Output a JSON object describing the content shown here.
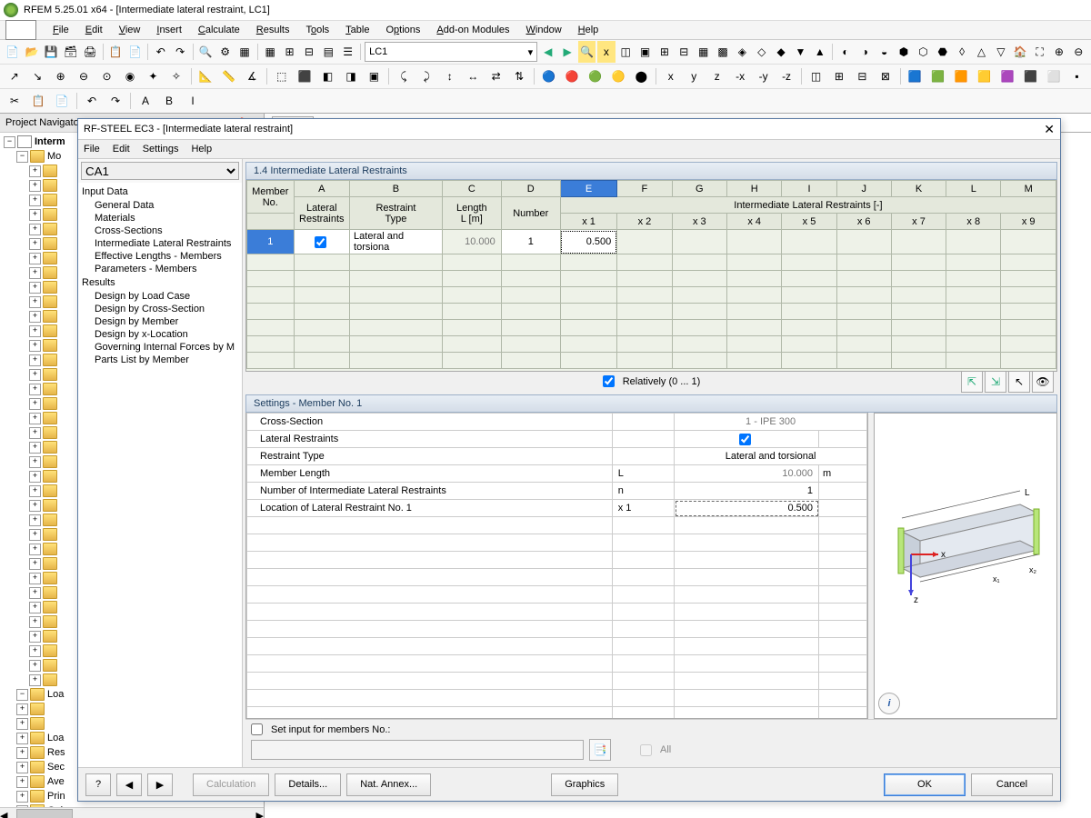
{
  "app": {
    "title": "RFEM 5.25.01 x64 - [Intermediate lateral restraint, LC1]",
    "menus": [
      "File",
      "Edit",
      "View",
      "Insert",
      "Calculate",
      "Results",
      "Tools",
      "Table",
      "Options",
      "Add-on Modules",
      "Window",
      "Help"
    ],
    "load_combo": "LC1",
    "tab": "LC1"
  },
  "navigator": {
    "title": "Project Navigator - Data",
    "root": "Interm",
    "items": [
      "Mo",
      "",
      "",
      "",
      "",
      "",
      "",
      "",
      "",
      "",
      "",
      "",
      "",
      "",
      "",
      "",
      "",
      "",
      "",
      "",
      "",
      "",
      "",
      "",
      "",
      "",
      "",
      "",
      "",
      "",
      "",
      "",
      "",
      "",
      "",
      "",
      "",
      "Loa",
      "",
      "",
      "Loa",
      "Res",
      "Sec",
      "Ave",
      "Prin",
      "Gui"
    ]
  },
  "modal": {
    "title": "RF-STEEL EC3 - [Intermediate lateral restraint]",
    "menus": [
      "File",
      "Edit",
      "Settings",
      "Help"
    ],
    "case_dropdown": "CA1",
    "nav": {
      "input_header": "Input Data",
      "input_items": [
        "General Data",
        "Materials",
        "Cross-Sections",
        "Intermediate Lateral Restraints",
        "Effective Lengths - Members",
        "Parameters - Members"
      ],
      "results_header": "Results",
      "results_items": [
        "Design by Load Case",
        "Design by Cross-Section",
        "Design by Member",
        "Design by x-Location",
        "Governing Internal Forces by M",
        "Parts List by Member"
      ]
    },
    "panel_title": "1.4 Intermediate Lateral Restraints",
    "grid": {
      "col_letters": [
        "A",
        "B",
        "C",
        "D",
        "E",
        "F",
        "G",
        "H",
        "I",
        "J",
        "K",
        "L",
        "M"
      ],
      "h_member": "Member\nNo.",
      "h_lateral": "Lateral\nRestraints",
      "h_type": "Restraint\nType",
      "h_length": "Length\nL [m]",
      "h_number": "Number",
      "h_restraints_group": "Intermediate Lateral Restraints [-]",
      "h_x": [
        "x 1",
        "x 2",
        "x 3",
        "x 4",
        "x 5",
        "x 6",
        "x 7",
        "x 8",
        "x 9"
      ],
      "row1": {
        "no": "1",
        "type": "Lateral and torsiona",
        "length": "10.000",
        "number": "1",
        "x1": "0.500"
      }
    },
    "relatively_label": "Relatively (0 ... 1)",
    "settings_title": "Settings - Member No. 1",
    "props": {
      "cross_section_lbl": "Cross-Section",
      "cross_section_val": "1 - IPE 300",
      "lateral_restraints_lbl": "Lateral Restraints",
      "restraint_type_lbl": "Restraint Type",
      "restraint_type_val": "Lateral and torsional",
      "member_length_lbl": "Member Length",
      "member_length_sym": "L",
      "member_length_val": "10.000",
      "member_length_unit": "m",
      "num_lbl": "Number of Intermediate Lateral Restraints",
      "num_sym": "n",
      "num_val": "1",
      "loc_lbl": "Location of Lateral Restraint No. 1",
      "loc_sym": "x 1",
      "loc_val": "0.500"
    },
    "set_input_label": "Set input for members No.:",
    "all_label": "All",
    "buttons": {
      "calculation": "Calculation",
      "details": "Details...",
      "nat_annex": "Nat. Annex...",
      "graphics": "Graphics",
      "ok": "OK",
      "cancel": "Cancel"
    }
  }
}
